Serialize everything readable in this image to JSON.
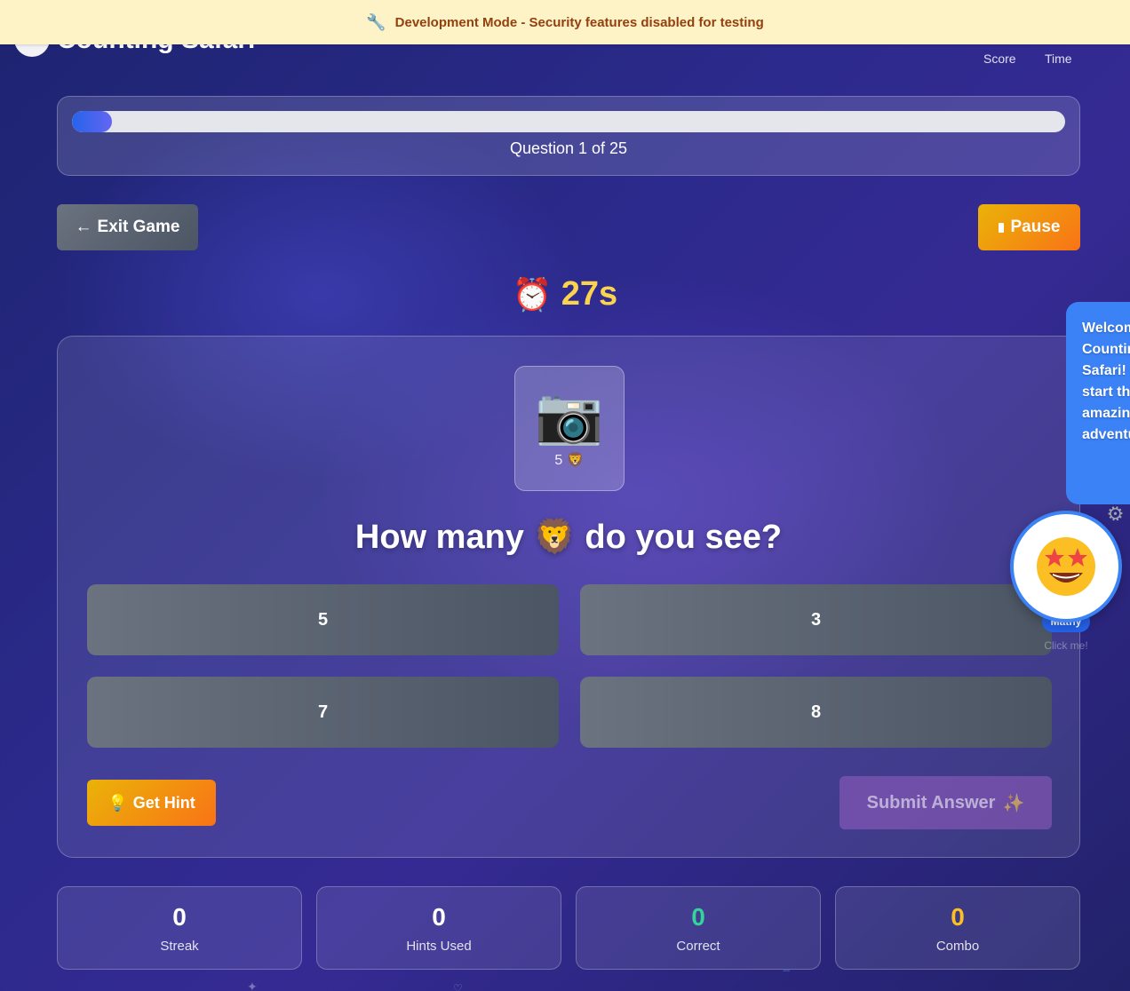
{
  "dev_banner": {
    "icon": "wrench-icon",
    "text": "Development Mode - Security features disabled for testing"
  },
  "header": {
    "title": "Counting Safari",
    "score_label": "Score",
    "time_label": "Time"
  },
  "progress": {
    "text": "Question 1 of 25",
    "fraction": 0.04
  },
  "controls": {
    "exit_label": "Exit Game",
    "exit_arrow": "←",
    "pause_label": "Pause"
  },
  "timer": {
    "value": "27s",
    "icon": "alarm-clock-icon"
  },
  "question": {
    "image_caption": "5 🦁",
    "image_icon": "camera-icon",
    "text": "How many 🦁 do you see?",
    "answers": [
      "5",
      "3",
      "7",
      "8"
    ]
  },
  "actions": {
    "hint_label": "Get Hint",
    "hint_icon": "💡",
    "submit_label": "Submit Answer",
    "submit_icon": "✨"
  },
  "stats": [
    {
      "value": "0",
      "label": "Streak",
      "color": "#ffffff"
    },
    {
      "value": "0",
      "label": "Hints Used",
      "color": "#ffffff"
    },
    {
      "value": "0",
      "label": "Correct",
      "color": "#34d399"
    },
    {
      "value": "0",
      "label": "Combo",
      "color": "#fbbf24"
    }
  ],
  "mascot": {
    "speech": "Welcome to Counting Safari! Let's start this amazing adventure",
    "name": "Mathy",
    "hint": "Click me!"
  },
  "colors": {
    "accent_blue": "#3b82f6",
    "warning_bg": "#fef3c7",
    "warning_text": "#92400e"
  }
}
